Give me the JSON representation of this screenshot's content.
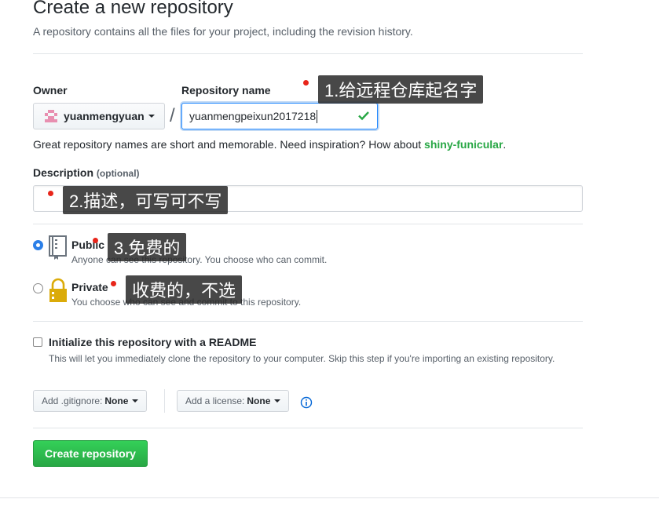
{
  "page": {
    "title": "Create a new repository",
    "subtitle": "A repository contains all the files for your project, including the revision history."
  },
  "owner": {
    "label": "Owner",
    "value": "yuanmengyuan"
  },
  "repo": {
    "label": "Repository name",
    "value": "yuanmengpeixun2017218",
    "separator": "/"
  },
  "hint": {
    "prefix": "Great repository names are short and memorable. Need inspiration? How about ",
    "suggestion": "shiny-funicular",
    "suffix": "."
  },
  "description": {
    "label": "Description",
    "optional": "(optional)",
    "value": ""
  },
  "visibility": {
    "public": {
      "title": "Public",
      "desc": "Anyone can see this repository. You choose who can commit.",
      "selected": true
    },
    "private": {
      "title": "Private",
      "desc": "You choose who can see and commit to this repository.",
      "selected": false
    }
  },
  "init": {
    "title": "Initialize this repository with a README",
    "desc": "This will let you immediately clone the repository to your computer. Skip this step if you're importing an existing repository.",
    "checked": false
  },
  "gitignore": {
    "label": "Add .gitignore:",
    "value": "None"
  },
  "license": {
    "label": "Add a license:",
    "value": "None"
  },
  "create_button": "Create repository",
  "annotations": {
    "a1": "1.给远程仓库起名字",
    "a2": "2.描述，可写可不写",
    "a3": "3.免费的",
    "a4": "收费的，不选"
  },
  "colors": {
    "accent": "#2188ff",
    "success": "#28a745",
    "annotation_dot": "#e8251a"
  },
  "icons": [
    "avatar-identicon",
    "check-icon",
    "repo-book-icon",
    "lock-icon",
    "info-icon",
    "caret-down-icon"
  ]
}
